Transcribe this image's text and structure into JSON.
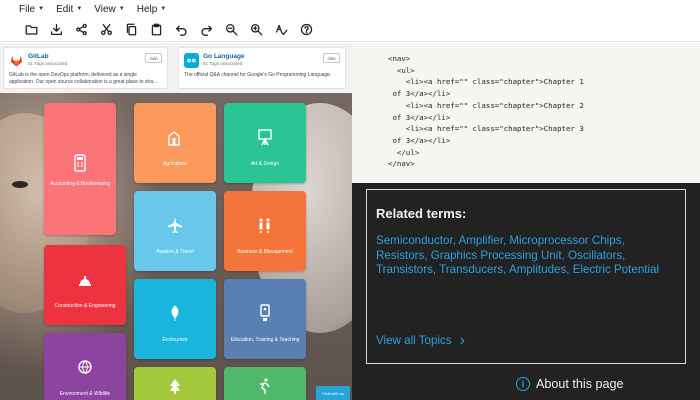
{
  "menu": [
    {
      "label": "File"
    },
    {
      "label": "Edit"
    },
    {
      "label": "View"
    },
    {
      "label": "Help"
    }
  ],
  "toolbar": [
    {
      "icon": "folder-icon"
    },
    {
      "icon": "download-icon"
    },
    {
      "icon": "share-icon"
    },
    {
      "icon": "cut-icon"
    },
    {
      "icon": "copy-icon"
    },
    {
      "icon": "paste-icon"
    },
    {
      "icon": "undo-icon"
    },
    {
      "icon": "redo-icon"
    },
    {
      "icon": "zoom-out-icon"
    },
    {
      "icon": "zoom-in-icon"
    },
    {
      "icon": "spellcheck-icon"
    },
    {
      "icon": "help-icon"
    }
  ],
  "cards": [
    {
      "name": "GitLab",
      "tags": "51 Tags associated",
      "desc": "GitLab is the open DevOps platform, delivered as a single application. Our open source collaboration is a great place to sha...",
      "join": "Join",
      "logo_color": "#e24329"
    },
    {
      "name": "Go Language",
      "tags": "51 Tags associated",
      "desc": "The official Q&A channel for Google's Go Programming Language.",
      "join": "Join",
      "logo_color": "#00add8"
    }
  ],
  "tiles": [
    {
      "label": "Accounting & Bookkeeping",
      "color": "#fa7478",
      "icon": "calculator-icon"
    },
    {
      "label": "Agriculture",
      "color": "#fb9a5c",
      "icon": "farm-icon"
    },
    {
      "label": "Art & Design",
      "color": "#2bc595",
      "icon": "easel-icon"
    },
    {
      "label": "Aviation & Travel",
      "color": "#69c7ec",
      "icon": "airplane-icon"
    },
    {
      "label": "Business & Management",
      "color": "#f5743a",
      "icon": "business-icon"
    },
    {
      "label": "Construction & Engineering",
      "color": "#ee3340",
      "icon": "hard-hat-icon"
    },
    {
      "label": "Ecotourism",
      "color": "#1ab5dc",
      "icon": "leaf-icon"
    },
    {
      "label": "Education, Training & Teaching",
      "color": "#5a80b2",
      "icon": "presentation-icon"
    },
    {
      "label": "Environment & Wildlife",
      "color": "#8c44a0",
      "icon": "globe-icon"
    },
    {
      "label": "",
      "color": "#a5c93c",
      "icon": "tree-icon"
    },
    {
      "label": "",
      "color": "#4fb86b",
      "icon": "runner-icon"
    }
  ],
  "chat_label": "Chat with us",
  "code": "<nav>\n  <ul>\n    <li><a href=\"\" class=\"chapter\">Chapter 1\n of 3</a></li>\n    <li><a href=\"\" class=\"chapter\">Chapter 2\n of 3</a></li>\n    <li><a href=\"\" class=\"chapter\">Chapter 3\n of 3</a></li>\n  </ul>\n</nav>",
  "related": {
    "heading": "Related terms:",
    "terms": "Semiconductor, Amplifier, Microprocessor Chips, Resistors, Graphics Processing Unit, Oscillators, Transistors, Transducers, Amplitudes, Electric Potential",
    "view_all": "View all Topics",
    "chevron": "›"
  },
  "about": {
    "label": "About this page",
    "info_glyph": "i"
  }
}
